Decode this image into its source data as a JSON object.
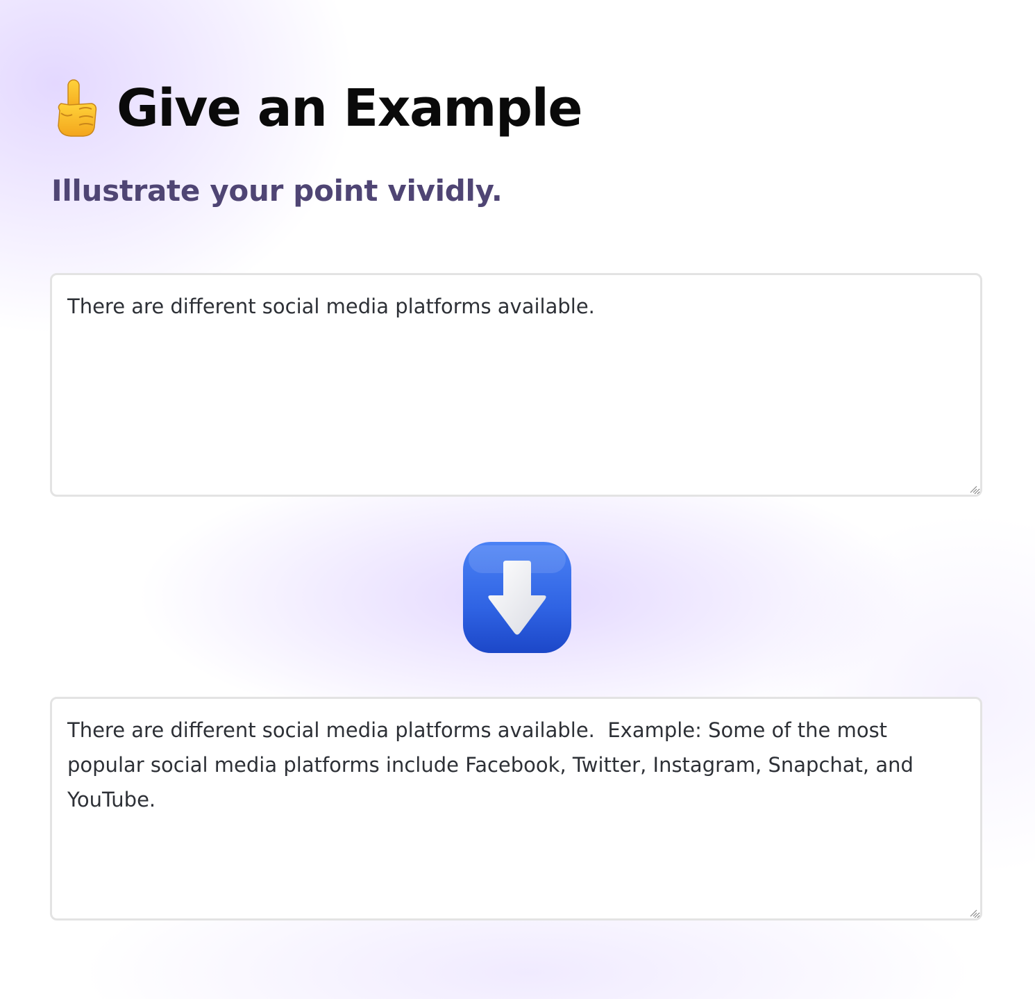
{
  "header": {
    "icon": "index-pointing-up-icon",
    "title": "Give an Example",
    "subtitle": "Illustrate your point vividly."
  },
  "input": {
    "value": "There are different social media platforms available."
  },
  "divider": {
    "icon": "down-arrow-icon",
    "accent": "#2f63e3"
  },
  "output": {
    "value": "There are different social media platforms available.  Example: Some of the most popular social media platforms include Facebook, Twitter, Instagram, Snapchat, and YouTube."
  },
  "colors": {
    "title": "#0a0a0a",
    "subtitle": "#4f4574",
    "text": "#2d3036",
    "border": "#e3e3e3",
    "glow": "#e2d6ff"
  }
}
